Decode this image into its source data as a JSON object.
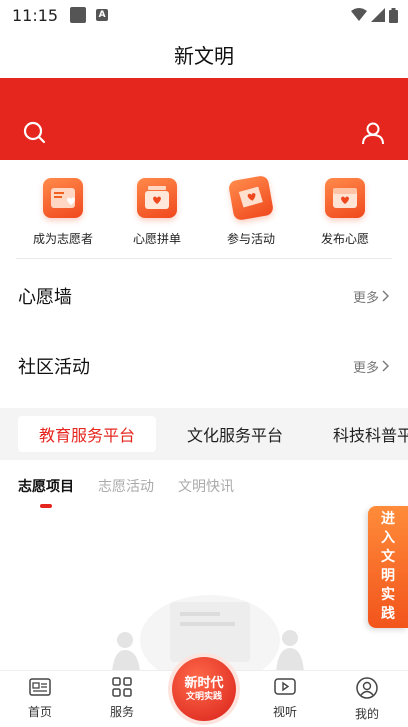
{
  "status_bar": {
    "time": "11:15",
    "a_label": "A"
  },
  "header": {
    "title": "新文明"
  },
  "quick_actions": [
    {
      "label": "成为志愿者",
      "icon": "volunteer-card-icon"
    },
    {
      "label": "心愿拼单",
      "icon": "wish-order-icon"
    },
    {
      "label": "参与活动",
      "icon": "activity-flag-icon"
    },
    {
      "label": "发布心愿",
      "icon": "publish-wish-icon"
    }
  ],
  "sections": {
    "wish_wall": {
      "title": "心愿墙",
      "more": "更多"
    },
    "community": {
      "title": "社区活动",
      "more": "更多"
    }
  },
  "platform_tabs": [
    {
      "label": "教育服务平台"
    },
    {
      "label": "文化服务平台"
    },
    {
      "label": "科技科普平台"
    }
  ],
  "sub_tabs": [
    {
      "label": "志愿项目"
    },
    {
      "label": "志愿活动"
    },
    {
      "label": "文明快讯"
    }
  ],
  "side_button": {
    "chars": [
      "进",
      "入",
      "文",
      "明",
      "实",
      "践"
    ]
  },
  "bottom_nav": {
    "home": "首页",
    "service": "服务",
    "center_line1": "新时代",
    "center_line2": "文明实践",
    "video": "视听",
    "mine": "我的"
  },
  "colors": {
    "primary_red": "#e5261f",
    "accent_orange": "#f2541c"
  }
}
